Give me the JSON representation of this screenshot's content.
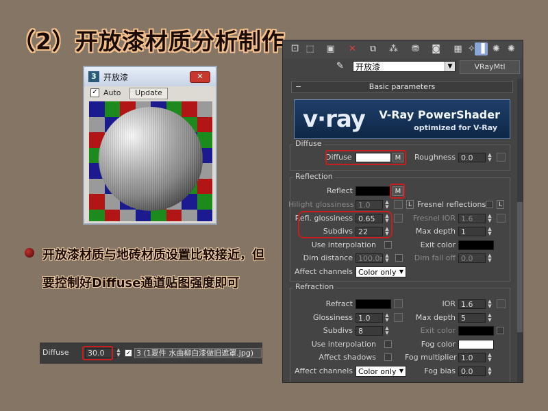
{
  "slide": {
    "title": "（2）开放漆材质分析制作",
    "bullet": "开放漆材质与地砖材质设置比较接近，但要控制好Diffuse通道贴图强度即可"
  },
  "preview_window": {
    "title": "开放漆",
    "auto_label": "Auto",
    "auto_checked": true,
    "update_label": "Update",
    "close_icon": "close-icon",
    "checker_colors": [
      "#1b1b8f",
      "#1d8a1d",
      "#b21515",
      "#9a9a9a"
    ]
  },
  "editor": {
    "toolbar_icons": [
      "get-material-icon",
      "put-to-scene-icon",
      "assign-material-icon",
      "reset-icon",
      "copy-icon",
      "unique-icon",
      "put-library-icon",
      "material-id-icon",
      "show-map-icon",
      "show-end-icon",
      "go-parent-icon",
      "go-forward-icon",
      "options-icon"
    ],
    "material_name": "开放漆",
    "material_type": "VRayMtl",
    "rollout_title": "Basic parameters",
    "banner": {
      "logo": "v·ray",
      "title": "V-Ray PowerShader",
      "subtitle": "optimized for V-Ray"
    },
    "diffuse_group": {
      "label": "Diffuse",
      "diffuse_label": "Diffuse",
      "diffuse_color": "#ffffff",
      "map_button": "M",
      "roughness_label": "Roughness",
      "roughness_value": "0.0"
    },
    "reflection_group": {
      "label": "Reflection",
      "reflect_label": "Reflect",
      "reflect_color": "#000000",
      "map_button": "M",
      "hilight_label": "Hilight glossiness",
      "hilight_value": "1.0",
      "lock_button": "L",
      "fresnel_label": "Fresnel reflections",
      "fresnel_lock_button": "L",
      "refl_gloss_label": "Refl. glossiness",
      "refl_gloss_value": "0.65",
      "fresnel_ior_label": "Fresnel IOR",
      "fresnel_ior_value": "1.6",
      "subdivs_label": "Subdivs",
      "subdivs_value": "22",
      "max_depth_label": "Max depth",
      "max_depth_value": "1",
      "use_interp_label": "Use interpolation",
      "exit_color_label": "Exit color",
      "exit_color": "#000000",
      "dim_distance_label": "Dim distance",
      "dim_distance_value": "100.0m",
      "dim_falloff_label": "Dim fall off",
      "dim_falloff_value": "0.0",
      "affect_label": "Affect channels",
      "affect_value": "Color only"
    },
    "refraction_group": {
      "label": "Refraction",
      "refract_label": "Refract",
      "refract_color": "#000000",
      "ior_label": "IOR",
      "ior_value": "1.6",
      "gloss_label": "Glossiness",
      "gloss_value": "1.0",
      "max_depth_label": "Max depth",
      "max_depth_value": "5",
      "subdivs_label": "Subdivs",
      "subdivs_value": "8",
      "exit_color_label": "Exit color",
      "exit_color": "#000000",
      "use_interp_label": "Use interpolation",
      "fog_color_label": "Fog color",
      "fog_color": "#ffffff",
      "affect_shadows_label": "Affect shadows",
      "fog_mult_label": "Fog multiplier",
      "fog_mult_value": "1.0",
      "affect_label": "Affect channels",
      "affect_value": "Color only",
      "fog_bias_label": "Fog bias",
      "fog_bias_value": "0.0"
    }
  },
  "maps_strip": {
    "label": "Diffuse",
    "amount": "30.0",
    "enabled": true,
    "map_name": "3 (1夏件 水曲柳白漆做旧遮罩.jpg)"
  },
  "colors": {
    "background": "#847565",
    "highlight": "#c81e1e",
    "title_text": "#1a0b05",
    "title_outline": "#f3c08c"
  }
}
